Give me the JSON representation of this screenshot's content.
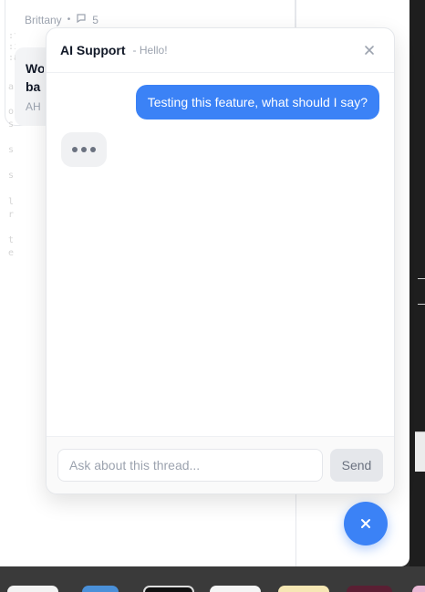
{
  "background_thread": {
    "author": "Brittany",
    "separator": "•",
    "comment_icon": "comment-icon",
    "comment_count": "5",
    "card_title": "Wo ba",
    "card_sub": "AH"
  },
  "chat": {
    "title": "AI Support",
    "subtitle": "- Hello!",
    "close_icon": "close-icon",
    "messages": [
      {
        "role": "user",
        "text": "Testing this feature, what should I say?"
      }
    ],
    "typing_indicator": true,
    "input_placeholder": "Ask about this thread...",
    "input_value": "",
    "send_label": "Send",
    "fab_icon": "close-icon"
  },
  "colors": {
    "accent": "#3b82f6",
    "panel_bg": "#ffffff",
    "bubble_bg": "#f0f1f3"
  }
}
